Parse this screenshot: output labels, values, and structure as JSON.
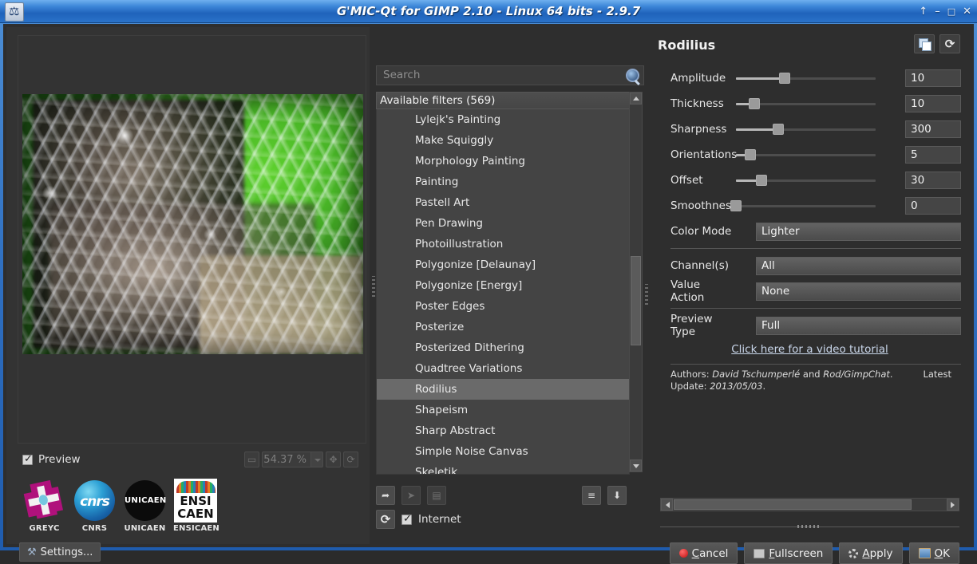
{
  "window": {
    "title": "G'MIC-Qt for GIMP 2.10 - Linux 64 bits - 2.9.7",
    "icon": "gmic-app-icon",
    "buttons": {
      "shade": "↑",
      "minimize": "–",
      "maximize": "□",
      "close": "✕"
    }
  },
  "preview": {
    "checkbox_label": "Preview",
    "checked": true,
    "zoom_value": "54.37 %",
    "zoom_buttons": {
      "fit": "▭",
      "center": "✥",
      "reset": "⟳"
    }
  },
  "logos": [
    {
      "name": "GREYC",
      "caption": "GREYC"
    },
    {
      "name": "CNRS",
      "caption": "CNRS",
      "text": "cnrs"
    },
    {
      "name": "UNICAEN",
      "caption": "UNICAEN",
      "text": "UNICAEN"
    },
    {
      "name": "ENSICAEN",
      "caption": "ENSICAEN",
      "line1": "ENSI",
      "line2": "CAEN"
    }
  ],
  "settings_button": "Settings...",
  "search": {
    "placeholder": "Search",
    "value": "",
    "icon": "search-icon"
  },
  "filter_list": {
    "header": "Available filters (569)",
    "count": 569,
    "selected": "Rodilius",
    "items": [
      "Lylejk's Painting",
      "Make Squiggly",
      "Morphology Painting",
      "Painting",
      "Pastell Art",
      "Pen Drawing",
      "Photoillustration",
      "Polygonize [Delaunay]",
      "Polygonize [Energy]",
      "Poster Edges",
      "Posterize",
      "Posterized Dithering",
      "Quadtree Variations",
      "Rodilius",
      "Shapeism",
      "Sharp Abstract",
      "Simple Noise Canvas",
      "Skeletik"
    ]
  },
  "list_tools": {
    "add_fave": "add-faves-icon",
    "add_fave2": "add-fave-icon",
    "rename": "rename-fave-icon",
    "manage": "manage-faves-icon",
    "download": "download-icon",
    "refresh": "refresh-icon",
    "internet_label": "Internet",
    "internet_checked": true
  },
  "filter_panel": {
    "title": "Rodilius",
    "copy_button": "copy-parameters-icon",
    "reset_button": "reset-parameters-icon",
    "parameters": [
      {
        "label": "Amplitude",
        "value": "10",
        "percent": 35
      },
      {
        "label": "Thickness",
        "value": "10",
        "percent": 13
      },
      {
        "label": "Sharpness",
        "value": "300",
        "percent": 30
      },
      {
        "label": "Orientations",
        "value": "5",
        "percent": 10
      },
      {
        "label": "Offset",
        "value": "30",
        "percent": 18
      },
      {
        "label": "Smoothness",
        "value": "0",
        "percent": 0
      }
    ],
    "combos": [
      {
        "label": "Color Mode",
        "value": "Lighter"
      },
      {
        "label": "Channel(s)",
        "value": "All"
      },
      {
        "label": "Value Action",
        "value": "None"
      },
      {
        "label": "Preview Type",
        "value": "Full"
      }
    ],
    "tutorial_link": "Click here for a video tutorial",
    "authors_prefix": "Authors: ",
    "author_1": "David Tschumperlé",
    "authors_join": " and ",
    "author_2": "Rod/GimpChat",
    "authors_suffix": ".",
    "latest_label": "Latest",
    "update_prefix": "Update: ",
    "update_date": "2013/05/03",
    "update_suffix": "."
  },
  "dialog_buttons": [
    {
      "label": "Cancel",
      "accel": "C",
      "icon": "cancel-icon"
    },
    {
      "label": "Fullscreen",
      "accel": "F",
      "icon": "fullscreen-icon"
    },
    {
      "label": "Apply",
      "accel": "A",
      "icon": "apply-icon"
    },
    {
      "label": "OK",
      "accel": "O",
      "icon": "ok-icon"
    }
  ],
  "colors": {
    "titlebar_blue": "#2f6fc0",
    "panel_bg": "#2e2e2e",
    "list_bg": "#444444",
    "selection": "#6a6a6a",
    "text": "#e8e8e8",
    "link": "#c9d6ea"
  }
}
